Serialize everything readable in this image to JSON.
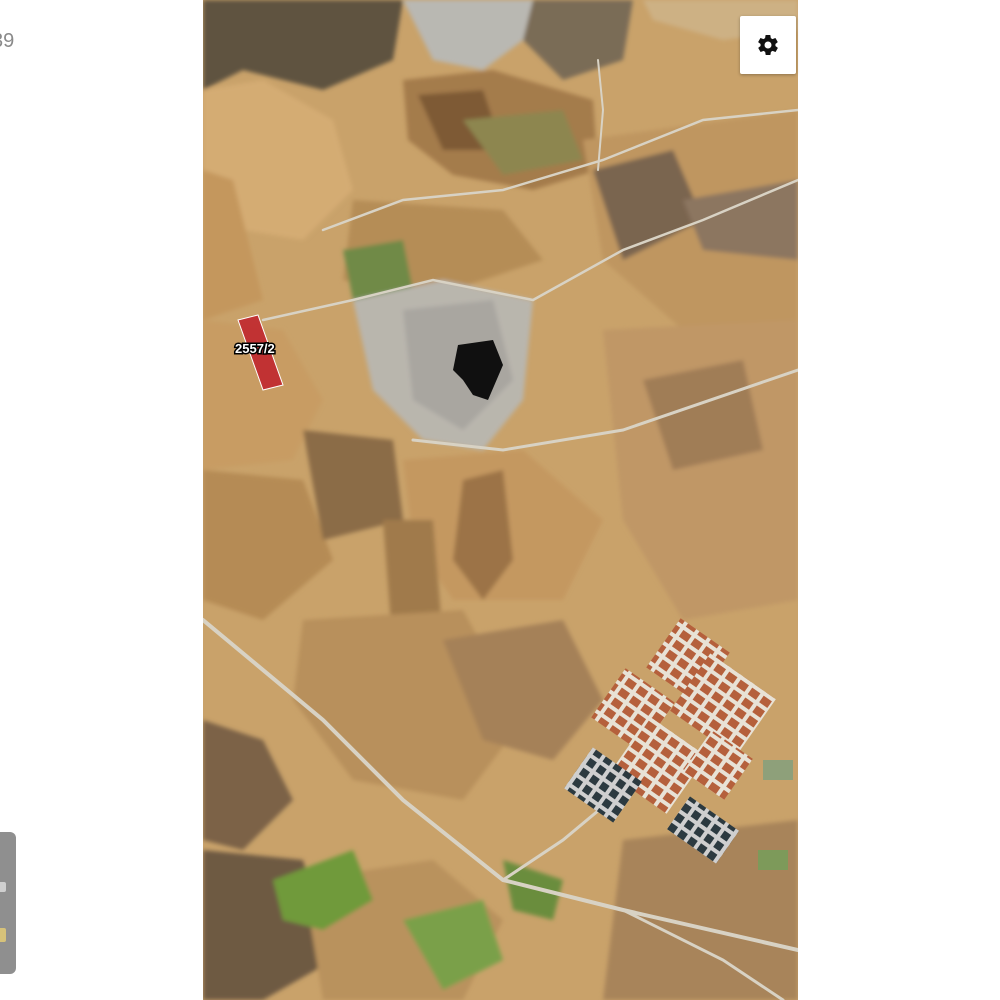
{
  "side_panel": {
    "partial_text": "39"
  },
  "controls": {
    "settings_icon": "gear-icon"
  },
  "map": {
    "type": "satellite",
    "parcel": {
      "label": "2557/2",
      "highlight_color": "#c0202a"
    }
  },
  "colors": {
    "terrain": "#c9a26a",
    "field_light": "#d8b27a",
    "field_dark": "#8a6a3e",
    "vegetation": "#6f9a3a",
    "quarry": "#b9b6ad",
    "water": "#101010",
    "road": "#d8d2c4"
  }
}
